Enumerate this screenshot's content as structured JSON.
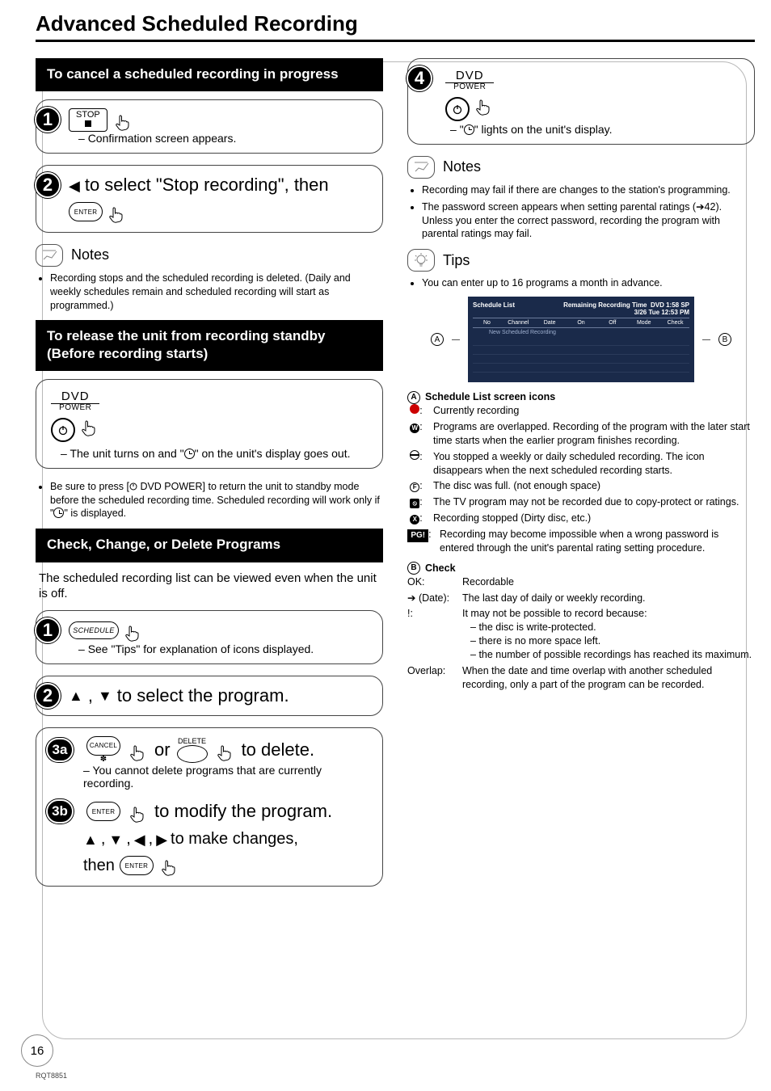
{
  "page": {
    "title": "Advanced Scheduled Recording",
    "number": "16",
    "doc_id": "RQT8851"
  },
  "left": {
    "cancel": {
      "heading": "To cancel a scheduled recording in progress",
      "step1": {
        "btn_top": "STOP",
        "after": "Confirmation screen appears."
      },
      "step2": {
        "prefix_arrow": "◀",
        "text": " to select \"Stop recording\", then",
        "enter": "ENTER"
      },
      "notes_label": "Notes",
      "notes": [
        "Recording stops and the scheduled recording is deleted. (Daily and weekly schedules remain and scheduled recording will start as programmed.)"
      ]
    },
    "release": {
      "heading_l1": "To release the unit from recording standby",
      "heading_l2": "(Before recording starts)",
      "dvd": {
        "l1": "DVD",
        "l2": "POWER"
      },
      "step_after_a": "The unit turns on and \"",
      "step_after_b": "\" on the unit's display goes out.",
      "bullet_a": "Be sure to press [",
      "bullet_b": " DVD POWER] to return the unit to standby mode before the scheduled recording time. Scheduled recording will work only if \"",
      "bullet_c": "\" is displayed."
    },
    "check": {
      "heading": "Check, Change, or Delete Programs",
      "para": "The scheduled recording list can be viewed even when the unit is off.",
      "step1": {
        "btn": "SCHEDULE",
        "after": "See \"Tips\" for explanation of icons displayed."
      },
      "step2": {
        "line": ", ",
        "tail": " to select the program."
      },
      "step3a": {
        "num": "3a",
        "cancel": "CANCEL",
        "asterisk": "✽",
        "or": "or",
        "delete": "DELETE",
        "tail": " to delete.",
        "sub": "You cannot delete programs that are currently recording."
      },
      "step3b": {
        "num": "3b",
        "enter": "ENTER",
        "line": " to modify the program.",
        "line2_tail": " to make changes,",
        "then": "then ",
        "enter2": "ENTER"
      }
    }
  },
  "right": {
    "step4": {
      "dvd_l1": "DVD",
      "dvd_l2": "POWER",
      "after_a": "\"",
      "after_b": "\" lights on the unit's display."
    },
    "notes_label": "Notes",
    "notes": [
      {
        "text": "Recording may fail if there are changes to the station's programming."
      },
      {
        "text": "The password screen appears when setting parental ratings (➔42). Unless you enter the correct password, recording the program with parental ratings may fail."
      }
    ],
    "tips_label": "Tips",
    "tips": [
      "You can enter up to 16 programs a month in advance."
    ],
    "figure": {
      "label_a": "A",
      "label_b": "B",
      "panel": {
        "title": "Schedule List",
        "rrt": "Remaining Recording Time",
        "rrt_val": "DVD 1:58 SP",
        "date": "3/26 Tue 12:53 PM",
        "cols": [
          "No",
          "Channel",
          "Date",
          "On",
          "Off",
          "Mode",
          "Check"
        ],
        "new_row": "New Scheduled Recording"
      }
    },
    "defs_a": {
      "heading": "Schedule List screen icons",
      "items": [
        {
          "icon": "rec",
          "text": "Currently recording"
        },
        {
          "icon": "W",
          "text": "Programs are overlapped. Recording of the program with the later start time starts when the earlier program finishes recording."
        },
        {
          "icon": "nodisc",
          "text": "You stopped a weekly or daily scheduled recording. The icon disappears when the next scheduled recording starts."
        },
        {
          "icon": "F",
          "text": "The disc was full. (not enough space)"
        },
        {
          "icon": "Zsq",
          "text": "The TV program may not be recorded due to copy-protect or ratings."
        },
        {
          "icon": "X",
          "text": "Recording stopped (Dirty disc, etc.)"
        },
        {
          "icon": "PGI",
          "text": "Recording may become impossible when a wrong password is entered through the unit's parental rating setting procedure."
        }
      ]
    },
    "defs_b": {
      "heading": "Check",
      "items": [
        {
          "key": "OK:",
          "text": "Recordable"
        },
        {
          "key": "➔ (Date):",
          "text": "The last day of daily or weekly recording."
        },
        {
          "key": "!:",
          "text": "It may not be possible to record because:",
          "sub": [
            "the disc is write-protected.",
            "there is no more space left.",
            "the number of possible recordings has reached its maximum."
          ]
        },
        {
          "key": "Overlap:",
          "text": "When the date and time overlap with another scheduled recording, only a part of the program can be recorded."
        }
      ]
    }
  }
}
